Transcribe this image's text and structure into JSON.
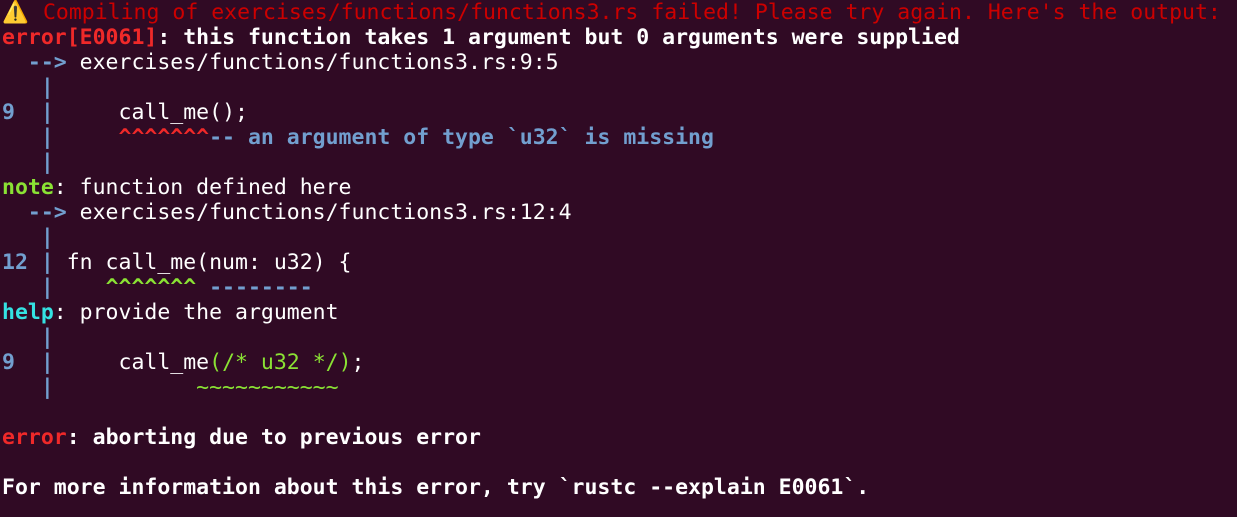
{
  "header": {
    "warning_icon": "warning-icon",
    "warning_glyph": "⚠️",
    "message": " Compiling of exercises/functions/functions3.rs failed! Please try again. Here's the output:"
  },
  "error": {
    "code": "error[E0061]",
    "message": ": this function takes 1 argument but 0 arguments were supplied",
    "arrow": "  --> ",
    "location": "exercises/functions/functions3.rs:9:5",
    "gutter": "   |",
    "line_number": "9",
    "line_gutter": "  |",
    "code_line": "     call_me();",
    "marker_indent": "   |     ",
    "marker": "^^^^^^^",
    "marker_label": "-- an argument of type `u32` is missing",
    "gutter_end": "   |"
  },
  "note": {
    "label": "note",
    "message": ": function defined here",
    "arrow": "  --> ",
    "location": "exercises/functions/functions3.rs:12:4",
    "gutter": "   |",
    "line_number": "12",
    "line_gutter": " |",
    "code_line": " fn call_me(num: u32) {",
    "marker_indent": "   |    ",
    "marker": "^^^^^^^",
    "marker_secondary": " --------"
  },
  "help": {
    "label": "help",
    "message": ": provide the argument",
    "gutter": "   |",
    "line_number": "9",
    "line_gutter": "  |",
    "code_prefix": "     call_me",
    "code_suggestion": "(/* u32 */)",
    "code_suffix": ";",
    "squiggle_indent": "   |           ",
    "squiggle": "~~~~~~~~~~~"
  },
  "abort": {
    "label": "error",
    "message": ": aborting due to previous error"
  },
  "footer": {
    "message": "For more information about this error, try `rustc --explain E0061`."
  },
  "colors": {
    "background": "#300a24",
    "fail_text": "#cc0000",
    "error": "#ef2929",
    "gutter_blue": "#729fcf",
    "note_green": "#8ae234",
    "help_cyan": "#34e2e2",
    "text": "#ffffff"
  }
}
